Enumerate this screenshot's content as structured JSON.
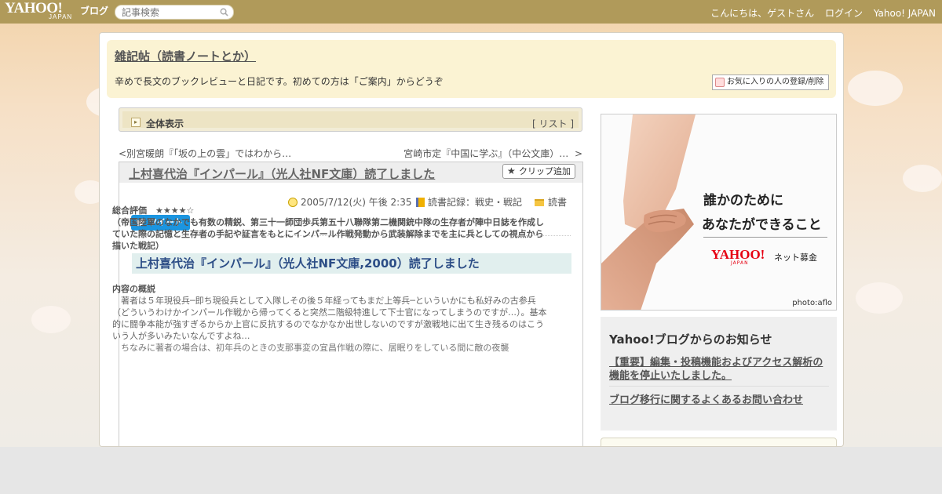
{
  "topbar": {
    "logo": "YAHOO!",
    "logo_sub": "JAPAN",
    "logo_service": "ブログ",
    "search_placeholder": "記事検索",
    "greeting": "こんにちは、ゲストさん",
    "login": "ログイン",
    "yahoo_japan": "Yahoo! JAPAN"
  },
  "blog": {
    "title": "雑記帖（読書ノートとか）",
    "description": "辛めで長文のブックレビューと日記です。初めての方は「ご案内」からどうぞ",
    "fav_button": "お気に入りの人の登録/削除"
  },
  "nav": {
    "show_all": "全体表示",
    "list_open": "[ ",
    "list_link": "リスト",
    "list_close": " ]",
    "prev_mark": "<",
    "prev_link": "別宮暖朗『「坂の上の雲」ではわから…",
    "next_link": "宮崎市定『中国に学ぶ』（中公文庫）…",
    "next_mark": ">"
  },
  "article": {
    "title": "上村喜代治『インパール』（光人社NF文庫）読了しました",
    "clip_button": "クリップ追加",
    "date": "2005/7/12(火) 午後 2:35",
    "category": "読書記録：戦史・戦記",
    "folder": "読書",
    "tweet": "ツイート",
    "heading": "上村喜代治『インパール』（光人社NF文庫,2000）読了しました",
    "rating": "総合評価　★★★★☆",
    "summary": "（帝国陸軍のなかでも有数の精鋭、第三十一師団歩兵第五十八聯隊第二機関銃中隊の生存者が陣中日誌を作成していた際の記憶と生存者の手記や証言をもとにインパール作戦発動から武装解除までを主に兵としての視点から描いた戦記）",
    "outline_title": "内容の概説",
    "outline_body": "　著者は５年現役兵─即ち現役兵として入隊しその後５年経ってもまだ上等兵─といういかにも私好みの古参兵（どういうわけかインパール作戦から帰ってくると突然二階級特進して下士官になってしまうのですが…）。基本的に闘争本能が強すぎるからか上官に反抗するのでなかなか出世しないのですが激戦地に出て生き残るのはこういう人が多いみたいなんですよね…",
    "more": "　ちなみに著者の場合は、初年兵のときの支那事変の宜昌作戦の際に、居眠りをしている間に敵の夜襲"
  },
  "ad": {
    "line1": "誰かのために",
    "line2": "あなたができること",
    "logo": "YAHOO!",
    "logo_sub": "JAPAN",
    "service": "ネット募金",
    "credit": "photo:aflo"
  },
  "notice": {
    "title": "Yahoo!ブログからのお知らせ",
    "item1": "【重要】編集・投稿機能およびアクセス解析の機能を停止いたしました。",
    "item2": "ブログ移行に関するよくあるお問い合わせ"
  },
  "colors": {
    "topbar": "#b09a5a",
    "header_box": "#fbf3d3",
    "heading_bg": "#e1efee",
    "heading_text": "#2c4d86",
    "tweet": "#1b95e0",
    "yahoo_red": "#e60012"
  }
}
